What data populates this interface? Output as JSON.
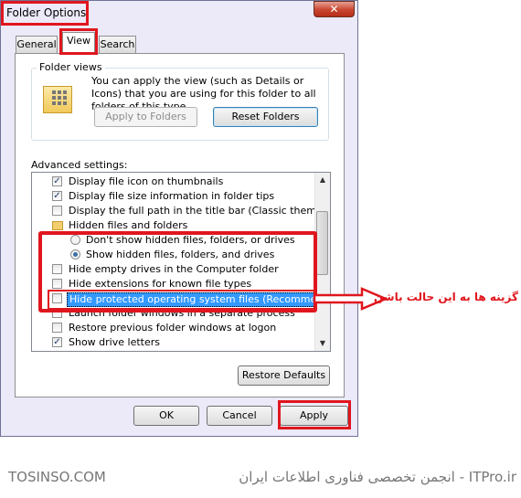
{
  "window": {
    "title": "Folder Options",
    "close_glyph": "✕"
  },
  "tabs": [
    {
      "label": "General"
    },
    {
      "label": "View"
    },
    {
      "label": "Search"
    }
  ],
  "folder_views": {
    "group_label": "Folder views",
    "description": "You can apply the view (such as Details or Icons) that you are using for this folder to all folders of this type.",
    "apply_button": "Apply to Folders",
    "reset_button": "Reset Folders"
  },
  "advanced": {
    "label": "Advanced settings:",
    "items": [
      {
        "label": "Display file icon on thumbnails",
        "control": "checkbox",
        "checked": true
      },
      {
        "label": "Display file size information in folder tips",
        "control": "checkbox",
        "checked": true
      },
      {
        "label": "Display the full path in the title bar (Classic theme only)",
        "control": "checkbox",
        "checked": false
      },
      {
        "label": "Hidden files and folders",
        "control": "folder"
      },
      {
        "label": "Don't show hidden files, folders, or drives",
        "control": "radio",
        "checked": false
      },
      {
        "label": "Show hidden files, folders, and drives",
        "control": "radio",
        "checked": true
      },
      {
        "label": "Hide empty drives in the Computer folder",
        "control": "checkbox",
        "checked": false
      },
      {
        "label": "Hide extensions for known file types",
        "control": "checkbox",
        "checked": false
      },
      {
        "label": "Hide protected operating system files (Recommended)",
        "control": "checkbox",
        "checked": false,
        "selected": true
      },
      {
        "label": "Launch folder windows in a separate process",
        "control": "checkbox",
        "checked": false
      },
      {
        "label": "Restore previous folder windows at logon",
        "control": "checkbox",
        "checked": false
      },
      {
        "label": "Show drive letters",
        "control": "checkbox",
        "checked": true
      }
    ],
    "restore_defaults": "Restore Defaults"
  },
  "dialog_buttons": {
    "ok": "OK",
    "cancel": "Cancel",
    "apply": "Apply"
  },
  "annotation": {
    "text": "گزینه ها به این حالت باشن",
    "color": "#e0161e"
  },
  "footer": {
    "left": "TOSINSO.COM",
    "right": "ITPro.ir - انجمن تخصصی فناوری اطلاعات ایران"
  },
  "icons": [
    "close-icon",
    "folder-options-icon",
    "folder-icon",
    "checkbox-icon",
    "radio-icon",
    "scroll-up-icon",
    "scroll-down-icon",
    "arrow-icon"
  ]
}
